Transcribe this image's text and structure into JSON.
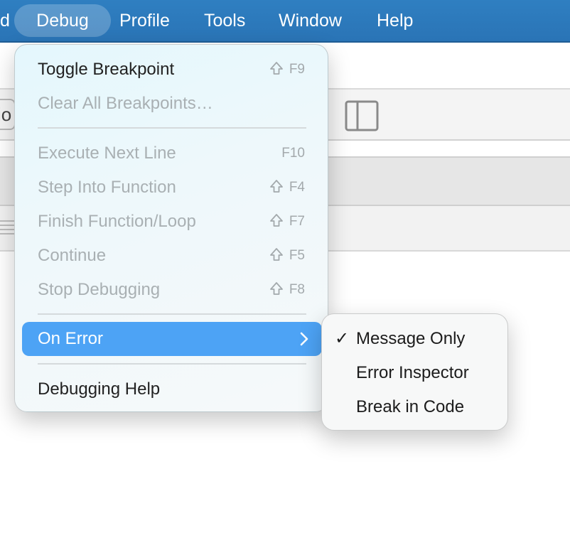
{
  "menubar": {
    "items": [
      {
        "label": "d"
      },
      {
        "label": "Debug"
      },
      {
        "label": "Profile"
      },
      {
        "label": "Tools"
      },
      {
        "label": "Window"
      },
      {
        "label": "Help"
      }
    ],
    "active_index": 1,
    "color": "#2f7fc1"
  },
  "background": {
    "field_text": "io"
  },
  "debug_menu": {
    "items": [
      {
        "label": "Toggle Breakpoint",
        "shortcut": "F9",
        "shift": true,
        "enabled": true
      },
      {
        "label": "Clear All Breakpoints…",
        "shortcut": "",
        "shift": false,
        "enabled": false
      },
      {
        "label": "Execute Next Line",
        "shortcut": "F10",
        "shift": false,
        "enabled": false
      },
      {
        "label": "Step Into Function",
        "shortcut": "F4",
        "shift": true,
        "enabled": false
      },
      {
        "label": "Finish Function/Loop",
        "shortcut": "F7",
        "shift": true,
        "enabled": false
      },
      {
        "label": "Continue",
        "shortcut": "F5",
        "shift": true,
        "enabled": false
      },
      {
        "label": "Stop Debugging",
        "shortcut": "F8",
        "shift": true,
        "enabled": false
      },
      {
        "label": "On Error",
        "shortcut": "",
        "submenu": true,
        "highlighted": true,
        "enabled": true
      },
      {
        "label": "Debugging Help",
        "shortcut": "",
        "shift": false,
        "enabled": true
      }
    ],
    "highlight_color": "#4da3f5"
  },
  "on_error_submenu": {
    "items": [
      {
        "label": "Message Only",
        "checked": true,
        "check": "✓"
      },
      {
        "label": "Error Inspector",
        "checked": false
      },
      {
        "label": "Break in Code",
        "checked": false
      }
    ]
  }
}
